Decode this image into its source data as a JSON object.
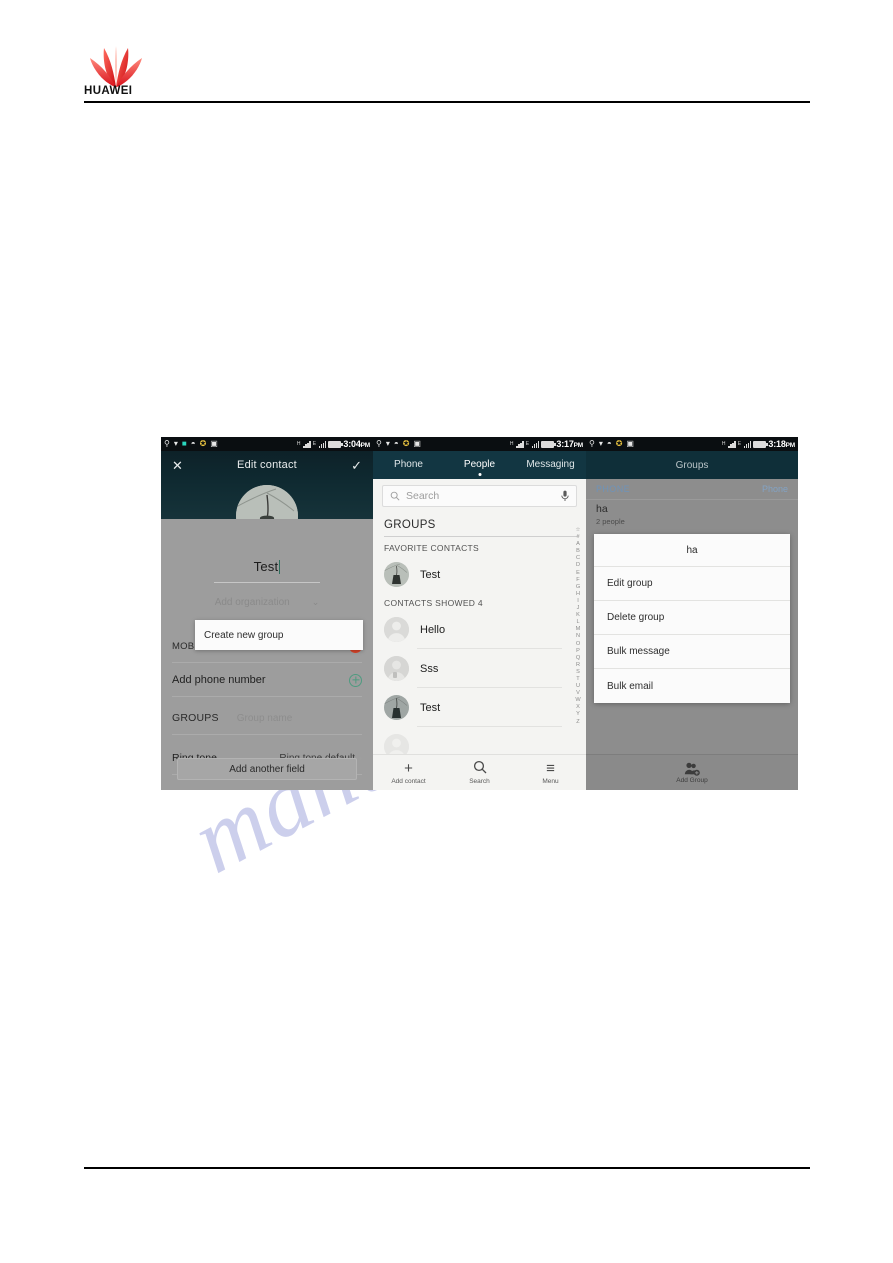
{
  "document": {
    "brand": "HUAWEI",
    "watermark": "manualshive.com"
  },
  "panels": [
    {
      "id": "edit-contact",
      "statusbar": {
        "time": "3:04",
        "meridiem": "PM",
        "icons": [
          "usb-icon",
          "wifi-icon",
          "sim-toolkit-icon",
          "android-icon",
          "mail-icon",
          "battery-saver-icon"
        ]
      },
      "appbar": {
        "close_label": "✕",
        "title": "Edit contact",
        "confirm_label": "✓"
      },
      "name_field": {
        "value": "Test"
      },
      "organization_field": {
        "placeholder": "Add organization",
        "chevron": "⌄"
      },
      "rows": {
        "mobile_label": "MOBI",
        "add_phone_number": "Add phone number",
        "groups_label": "GROUPS",
        "group_name_placeholder": "Group name",
        "ring_tone_label": "Ring tone",
        "ring_tone_value": "Ring tone default"
      },
      "popup": {
        "label": "Create new group"
      },
      "add_another_field": "Add another field"
    },
    {
      "id": "people",
      "statusbar": {
        "time": "3:17",
        "meridiem": "PM",
        "icons": [
          "usb-icon",
          "wifi-icon",
          "android-icon",
          "mail-icon",
          "battery-saver-icon"
        ]
      },
      "tabs": [
        {
          "label": "Phone",
          "active": false
        },
        {
          "label": "People",
          "active": true
        },
        {
          "label": "Messaging",
          "active": false
        }
      ],
      "search": {
        "placeholder": "Search",
        "mic": "voice-search-icon"
      },
      "groups_row": "GROUPS",
      "sections": [
        {
          "title": "FAVORITE CONTACTS"
        },
        {
          "title": "CONTACTS SHOWED 4"
        }
      ],
      "favorites": [
        {
          "name": "Test"
        }
      ],
      "contacts": [
        {
          "name": "Hello"
        },
        {
          "name": "Sss"
        },
        {
          "name": "Test"
        }
      ],
      "index": [
        "☆",
        "#",
        "A",
        "B",
        "C",
        "D",
        "E",
        "F",
        "G",
        "H",
        "I",
        "J",
        "K",
        "L",
        "M",
        "N",
        "O",
        "P",
        "Q",
        "R",
        "S",
        "T",
        "U",
        "V",
        "W",
        "X",
        "Y",
        "Z"
      ],
      "nav": [
        {
          "icon": "plus-icon",
          "label": "Add contact"
        },
        {
          "icon": "search-icon",
          "label": "Search"
        },
        {
          "icon": "menu-icon",
          "label": "Menu"
        }
      ]
    },
    {
      "id": "groups",
      "statusbar": {
        "time": "3:18",
        "meridiem": "PM",
        "icons": [
          "usb-icon",
          "wifi-icon",
          "android-icon",
          "mail-icon",
          "battery-saver-icon"
        ]
      },
      "title": "Groups",
      "section": {
        "left": "PHONE",
        "right": "Phone"
      },
      "group": {
        "name": "ha",
        "count": "2 people"
      },
      "menu": {
        "header": "ha",
        "items": [
          "Edit group",
          "Delete group",
          "Bulk message",
          "Bulk email"
        ]
      },
      "bottom": {
        "icon": "add-group-icon",
        "label": "Add Group"
      }
    }
  ],
  "colors": {
    "brand_red": "#e2231a",
    "appbar_dark": "#123642",
    "accent_green": "#4f9b80",
    "accent_red": "#d9442a",
    "watermark": "#b9bde6"
  }
}
